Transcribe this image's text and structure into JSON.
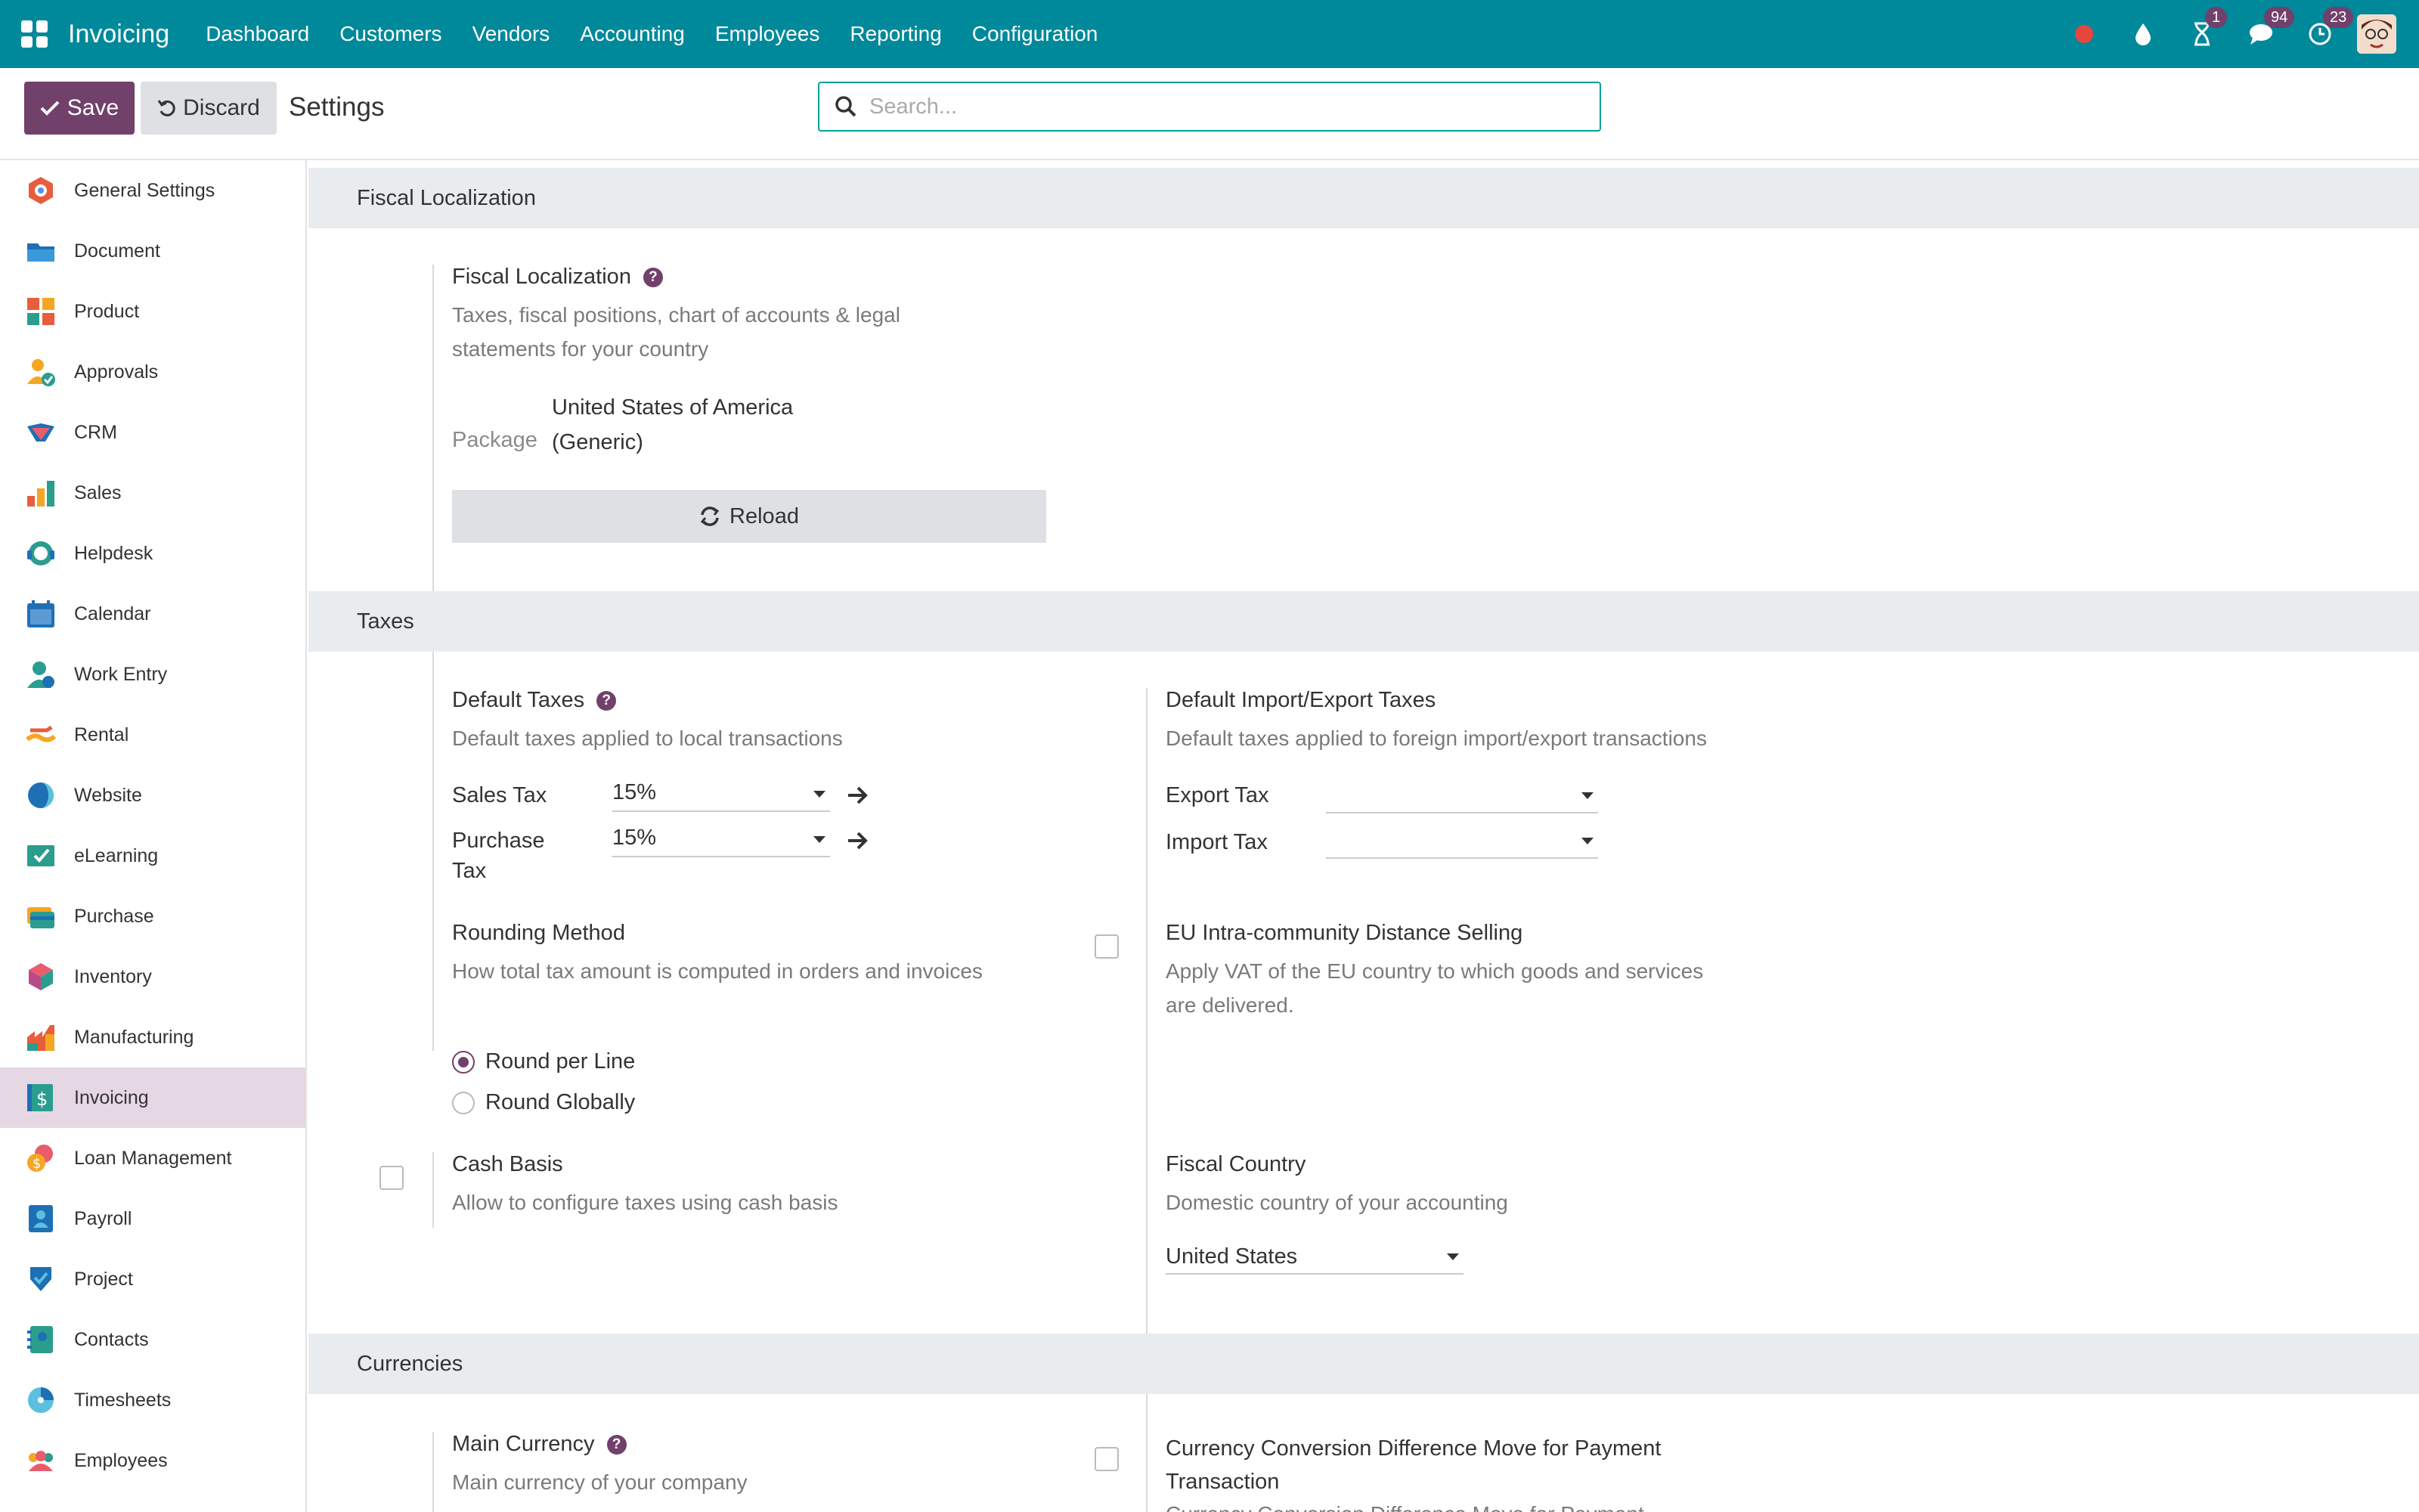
{
  "navbar": {
    "brand": "Invoicing",
    "menu": [
      "Dashboard",
      "Customers",
      "Vendors",
      "Accounting",
      "Employees",
      "Reporting",
      "Configuration"
    ],
    "badges": {
      "activities": "1",
      "messages": "94",
      "notifications": "23"
    }
  },
  "control": {
    "save_label": "Save",
    "discard_label": "Discard",
    "title": "Settings",
    "search_placeholder": "Search..."
  },
  "sidebar": {
    "items": [
      {
        "label": "General Settings",
        "icon": "general-settings-icon"
      },
      {
        "label": "Document",
        "icon": "document-icon"
      },
      {
        "label": "Product",
        "icon": "product-icon"
      },
      {
        "label": "Approvals",
        "icon": "approvals-icon"
      },
      {
        "label": "CRM",
        "icon": "crm-icon"
      },
      {
        "label": "Sales",
        "icon": "sales-icon"
      },
      {
        "label": "Helpdesk",
        "icon": "helpdesk-icon"
      },
      {
        "label": "Calendar",
        "icon": "calendar-icon"
      },
      {
        "label": "Work Entry",
        "icon": "work-entry-icon"
      },
      {
        "label": "Rental",
        "icon": "rental-icon"
      },
      {
        "label": "Website",
        "icon": "website-icon"
      },
      {
        "label": "eLearning",
        "icon": "elearning-icon"
      },
      {
        "label": "Purchase",
        "icon": "purchase-icon"
      },
      {
        "label": "Inventory",
        "icon": "inventory-icon"
      },
      {
        "label": "Manufacturing",
        "icon": "manufacturing-icon"
      },
      {
        "label": "Invoicing",
        "icon": "invoicing-icon",
        "active": true
      },
      {
        "label": "Loan Management",
        "icon": "loan-management-icon"
      },
      {
        "label": "Payroll",
        "icon": "payroll-icon"
      },
      {
        "label": "Project",
        "icon": "project-icon"
      },
      {
        "label": "Contacts",
        "icon": "contacts-icon"
      },
      {
        "label": "Timesheets",
        "icon": "timesheets-icon"
      },
      {
        "label": "Employees",
        "icon": "employees-icon"
      }
    ]
  },
  "fiscal": {
    "section": "Fiscal Localization",
    "title": "Fiscal Localization",
    "desc_line1": "Taxes, fiscal positions, chart of accounts & legal",
    "desc_line2": "statements for your country",
    "package_label": "Package",
    "package_value_line1": "United States of America",
    "package_value_line2": "(Generic)",
    "reload_label": "Reload"
  },
  "taxes": {
    "section": "Taxes",
    "default_title": "Default Taxes",
    "default_desc": "Default taxes applied to local transactions",
    "sales_tax_label": "Sales Tax",
    "sales_tax_value": "15%",
    "purchase_tax_label_line1": "Purchase",
    "purchase_tax_label_line2": "Tax",
    "purchase_tax_value": "15%",
    "importexport_title": "Default Import/Export Taxes",
    "importexport_desc": "Default taxes applied to foreign import/export transactions",
    "export_tax_label": "Export Tax",
    "export_tax_value": "",
    "import_tax_label": "Import Tax",
    "import_tax_value": "",
    "rounding_title": "Rounding Method",
    "rounding_desc": "How total tax amount is computed in orders and invoices",
    "round_per_line": "Round per Line",
    "round_globally": "Round Globally",
    "eu_title": "EU Intra-community Distance Selling",
    "eu_desc_line1": "Apply VAT of the EU country to which goods and services",
    "eu_desc_line2": "are delivered.",
    "cash_title": "Cash Basis",
    "cash_desc": "Allow to configure taxes using cash basis",
    "fiscal_country_title": "Fiscal Country",
    "fiscal_country_desc": "Domestic country of your accounting",
    "fiscal_country_value": "United States"
  },
  "currencies": {
    "section": "Currencies",
    "main_title": "Main Currency",
    "main_desc": "Main currency of your company",
    "conv_title_line1": "Currency Conversion Difference Move for Payment",
    "conv_title_line2": "Transaction",
    "conv_desc": "Currency Conversion Difference Move for Payment"
  },
  "colors": {
    "navbar": "#00899a",
    "primary": "#71406b",
    "accent": "#00a09d"
  }
}
